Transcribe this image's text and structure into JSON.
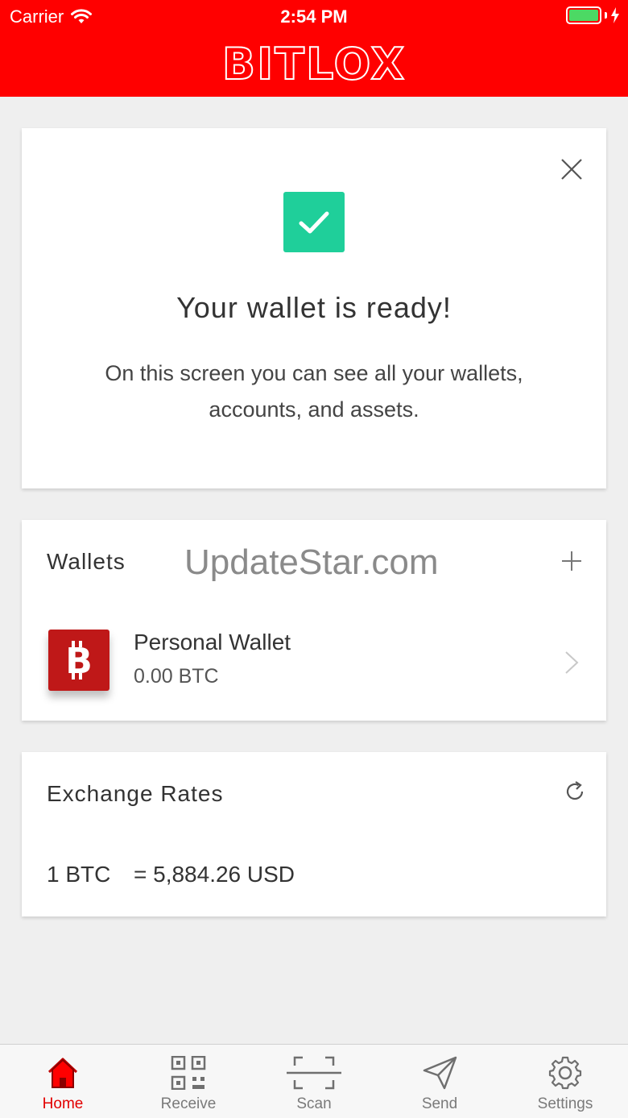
{
  "status_bar": {
    "carrier": "Carrier",
    "time": "2:54 PM"
  },
  "header": {
    "logo": "BITLOX"
  },
  "ready_card": {
    "title": "Your wallet is ready!",
    "description": "On this screen you can see all your wallets, accounts, and assets."
  },
  "wallets_card": {
    "title": "Wallets",
    "watermark": "UpdateStar.com",
    "wallets": [
      {
        "name": "Personal Wallet",
        "balance": "0.00 BTC"
      }
    ]
  },
  "rates_card": {
    "title": "Exchange Rates",
    "rates": [
      {
        "left": "1 BTC",
        "right": "= 5,884.26 USD"
      }
    ]
  },
  "tabbar": {
    "tabs": [
      {
        "label": "Home",
        "icon": "home-icon",
        "active": true
      },
      {
        "label": "Receive",
        "icon": "qr-code-icon",
        "active": false
      },
      {
        "label": "Scan",
        "icon": "scan-icon",
        "active": false
      },
      {
        "label": "Send",
        "icon": "send-icon",
        "active": false
      },
      {
        "label": "Settings",
        "icon": "gear-icon",
        "active": false
      }
    ]
  },
  "colors": {
    "brand_red": "#ff0000",
    "success_green": "#1fcf9a",
    "wallet_red": "#bf1818",
    "active_tab": "#e20000"
  }
}
